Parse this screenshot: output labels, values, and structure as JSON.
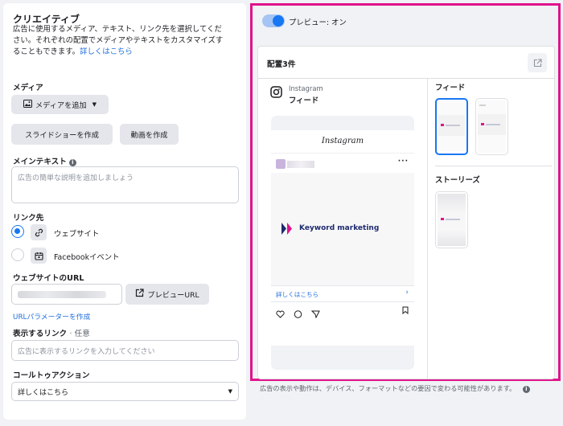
{
  "creative": {
    "title": "クリエイティブ",
    "description_lines": [
      "広告に使用するメディア、テキスト、リンク先を選択してくだ",
      "さい。それぞれの配置でメディアやテキストをカスタマイズす",
      "ることもできます。"
    ],
    "learn_more": "詳しくはこちら"
  },
  "media": {
    "label": "メディア",
    "add_media": "メディアを追加",
    "slideshow": "スライドショーを作成",
    "video": "動画を作成"
  },
  "main_text": {
    "label": "メインテキスト",
    "placeholder": "広告の簡単な説明を追加しましょう"
  },
  "destination": {
    "label": "リンク先",
    "options": [
      "ウェブサイト",
      "Facebookイベント"
    ]
  },
  "website_url": {
    "label": "ウェブサイトのURL",
    "preview_url": "プレビューURL",
    "url_params": "URLパラメーターを作成"
  },
  "display_link": {
    "label": "表示するリンク",
    "optional": "· 任意",
    "placeholder": "広告に表示するリンクを入力してください"
  },
  "cta": {
    "label": "コールトゥアクション",
    "value": "詳しくはこちら"
  },
  "preview": {
    "toggle_label": "プレビュー: オン",
    "placements_title": "配置3件",
    "platform": "Instagram",
    "placement": "フィード",
    "phone_header": "Instagram",
    "brand": "Keyword marketing",
    "cta_link": "詳しくはこちら",
    "feed_label": "フィード",
    "stories_label": "ストーリーズ",
    "footer_note": "広告の表示や動作は、デバイス、フォーマットなどの要因で変わる可能性があります。"
  },
  "colors": {
    "accent": "#1877f2",
    "highlight_frame": "#e0138c",
    "link": "#216fdb"
  }
}
